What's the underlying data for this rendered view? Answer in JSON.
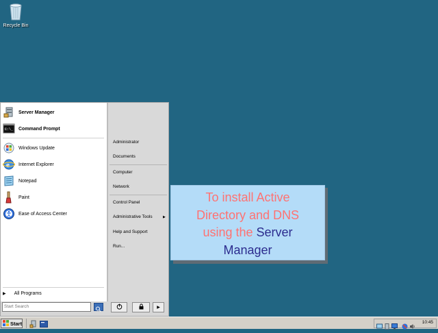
{
  "desktop": {
    "recycle_bin_label": "Recycle Bin"
  },
  "start_menu": {
    "pinned": [
      {
        "label": "Server Manager",
        "icon": "server-manager-icon"
      },
      {
        "label": "Command Prompt",
        "icon": "command-prompt-icon"
      }
    ],
    "recent": [
      {
        "label": "Windows Update",
        "icon": "windows-update-icon"
      },
      {
        "label": "Internet Explorer",
        "icon": "internet-explorer-icon"
      },
      {
        "label": "Notepad",
        "icon": "notepad-icon"
      },
      {
        "label": "Paint",
        "icon": "paint-icon"
      },
      {
        "label": "Ease of Access Center",
        "icon": "ease-of-access-icon"
      }
    ],
    "all_programs": "All Programs",
    "right": [
      "Administrator",
      "Documents",
      "Computer",
      "Network",
      "Control Panel",
      "Administrative Tools",
      "Help and Support",
      "Run..."
    ],
    "search_placeholder": "Start Search"
  },
  "callout": {
    "line1": "To install Active",
    "line2": "Directory and DNS",
    "line3_pink": "using the ",
    "line3_blue": "Server",
    "line4": "Manager"
  },
  "taskbar": {
    "start_label": "Start",
    "clock": "10:45"
  },
  "colors": {
    "desktop": "#216582",
    "callout_bg": "#b4dcf8",
    "callout_pink": "#ff7272",
    "callout_blue": "#2c2c8e"
  }
}
